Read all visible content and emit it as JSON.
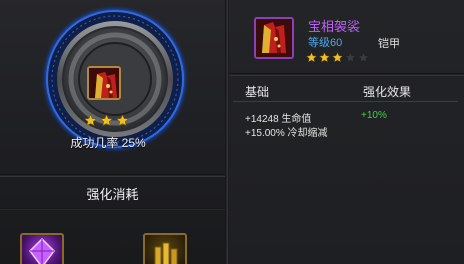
{
  "enhance_panel": {
    "success_rate_text": "成功几率 25%",
    "star_count": 3,
    "cost_title": "强化消耗",
    "cost_items": [
      {
        "icon": "purple-crystal-icon"
      },
      {
        "icon": "gold-coins-icon"
      }
    ]
  },
  "item_info": {
    "name": "宝相袈裟",
    "level_text": "等级60",
    "type_text": "铠甲",
    "stars_filled": 3,
    "stars_total": 5,
    "icon": "red-robe-icon"
  },
  "stats": {
    "base_header": "基础",
    "effect_header": "强化效果",
    "rows": [
      {
        "base": "+14248 生命值",
        "bonus": "+10%"
      },
      {
        "base": "+15.00% 冷却缩减",
        "bonus": ""
      }
    ]
  },
  "colors": {
    "item_name": "#c060ff",
    "level": "#4fa8e8",
    "bonus": "#3fd43f",
    "ring_blue": "#1f5fd0"
  }
}
